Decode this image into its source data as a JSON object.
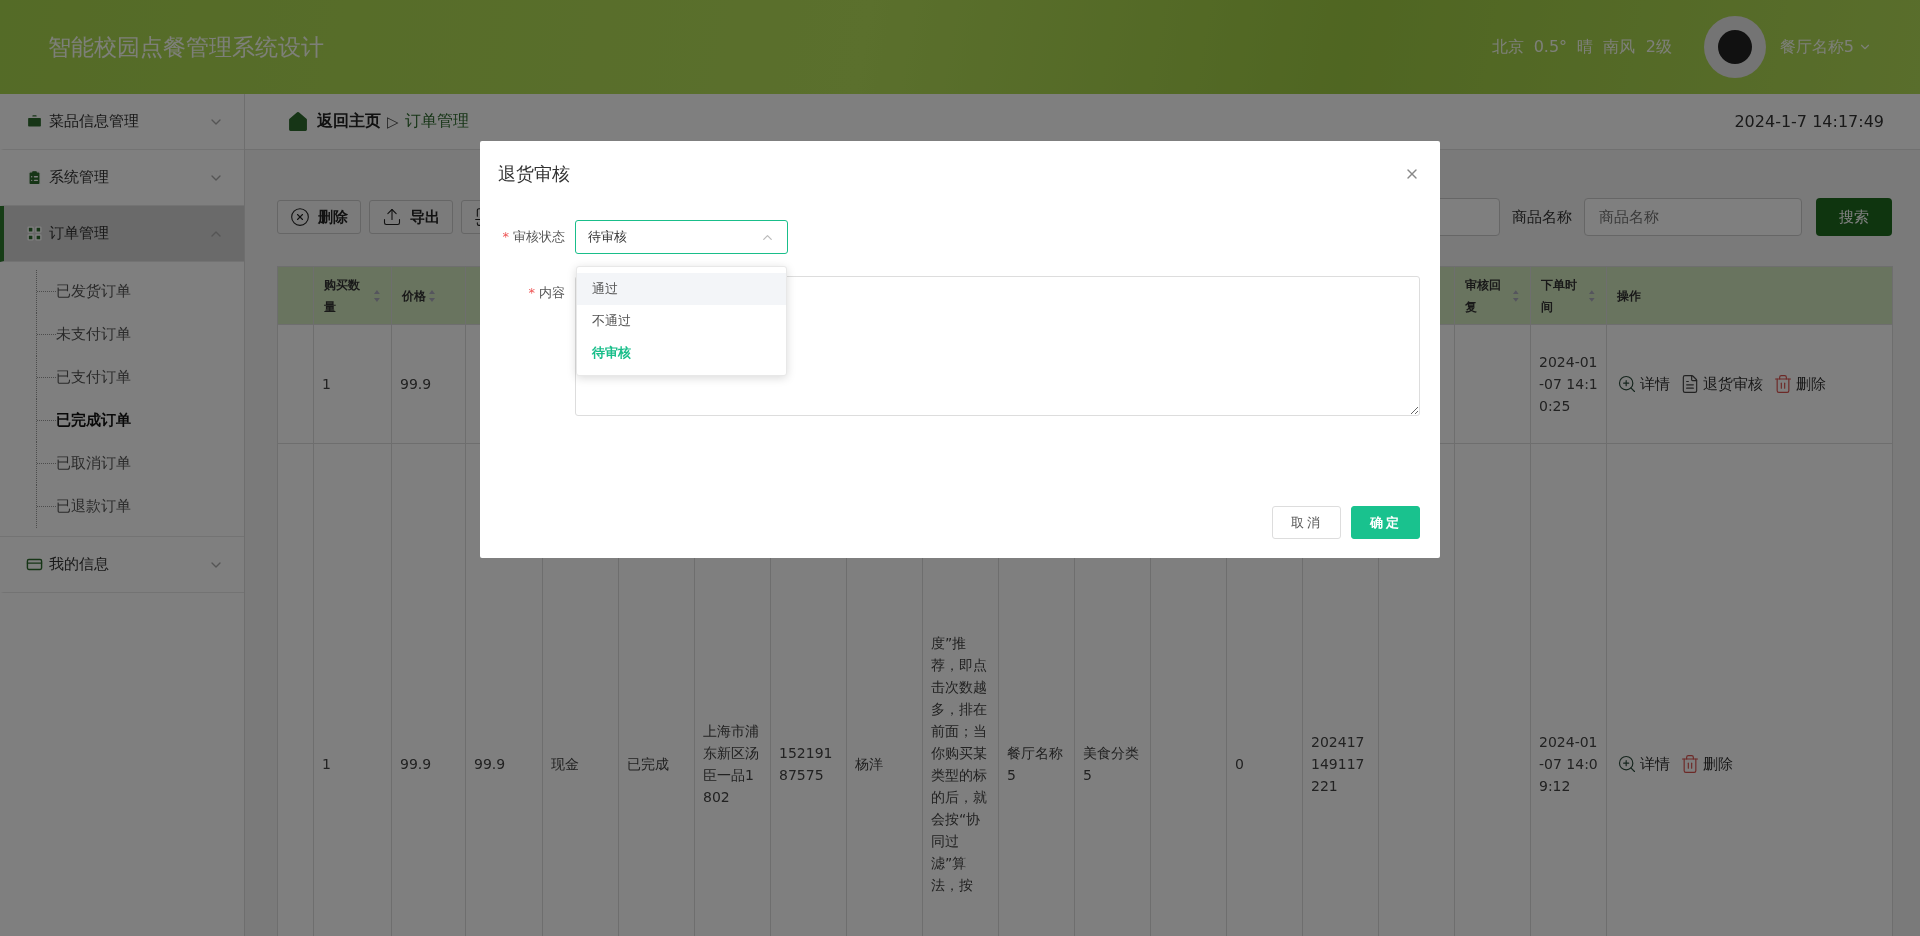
{
  "header": {
    "title": "智能校园点餐管理系统设计",
    "weather": "北京  0.5°  晴  南风  2级",
    "user": "餐厅名称5"
  },
  "sidebar": {
    "items": [
      {
        "label": "菜品信息管理",
        "expanded": false,
        "selected": false
      },
      {
        "label": "系统管理",
        "expanded": false,
        "selected": false
      },
      {
        "label": "订单管理",
        "expanded": true,
        "selected": true,
        "children": [
          {
            "label": "已发货订单",
            "selected": false
          },
          {
            "label": "未支付订单",
            "selected": false
          },
          {
            "label": "已支付订单",
            "selected": false
          },
          {
            "label": "已完成订单",
            "selected": true
          },
          {
            "label": "已取消订单",
            "selected": false
          },
          {
            "label": "已退款订单",
            "selected": false
          }
        ]
      },
      {
        "label": "我的信息",
        "expanded": false,
        "selected": false
      }
    ]
  },
  "breadcrumb": {
    "home": "返回主页",
    "separator": "▷",
    "current": "订单管理",
    "datetime": "2024-1-7 14:17:49"
  },
  "toolbar": {
    "buttons": [
      {
        "kind": "delete",
        "label": "删除"
      },
      {
        "kind": "export",
        "label": "导出"
      },
      {
        "kind": "import"
      }
    ],
    "filters": [
      {
        "kind": "field"
      },
      {
        "kind": "labeled",
        "label": "商品名称",
        "placeholder": "商品名称"
      }
    ],
    "search_button": "搜索"
  },
  "table": {
    "columns": [
      {
        "sortable": false
      },
      {
        "label": "购买数量",
        "sortable": true
      },
      {
        "label": "价格",
        "sortable": true
      },
      {
        "sortable": false
      }
    ],
    "columns_right": [
      {
        "sortable": false
      },
      {
        "label": "审核回复",
        "sortable": true
      },
      {
        "label": "下单时间",
        "sortable": true
      },
      {
        "label": "操作",
        "sortable": false
      }
    ],
    "rows": [
      {
        "cells": [
          null,
          "1",
          "99.9",
          null,
          null,
          null,
          null,
          null,
          null,
          null,
          null,
          null,
          null,
          null,
          null,
          null,
          null,
          "2024-01-07 14:10:25"
        ],
        "actions": [
          {
            "kind": "detail",
            "label": "详情"
          },
          {
            "kind": "review",
            "label": "退货审核"
          },
          {
            "kind": "delete",
            "label": "删除"
          }
        ]
      },
      {
        "cells": [
          null,
          "1",
          "99.9",
          "99.9",
          "现金",
          "已完成",
          "上海市浦东新区汤臣一品1802",
          "15219187575",
          "杨洋",
          "度”推荐，即点击次数越多，排在前面；当你购买某类型的标的后，就会按“协同过滤”算法，按",
          "餐厅名称5",
          "美食分类5",
          null,
          "0",
          "202417149117221",
          null,
          null,
          "2024-01-07 14:09:12"
        ],
        "actions": [
          {
            "kind": "detail",
            "label": "详情"
          },
          {
            "kind": "delete",
            "label": "删除"
          }
        ]
      }
    ]
  },
  "dialog": {
    "title": "退货审核",
    "fields": [
      {
        "kind": "select",
        "label": "审核状态",
        "required_mark": "*",
        "value": "待审核",
        "open": true,
        "options": [
          {
            "label": "通过",
            "selected": false,
            "hovered": true
          },
          {
            "label": "不通过",
            "selected": false,
            "hovered": false
          },
          {
            "label": "待审核",
            "selected": true,
            "hovered": false
          }
        ]
      },
      {
        "kind": "textarea",
        "label": "内容",
        "required_mark": "*"
      }
    ],
    "buttons": [
      {
        "kind": "secondary",
        "label": "取消"
      },
      {
        "kind": "primary",
        "label": "确定"
      }
    ]
  }
}
